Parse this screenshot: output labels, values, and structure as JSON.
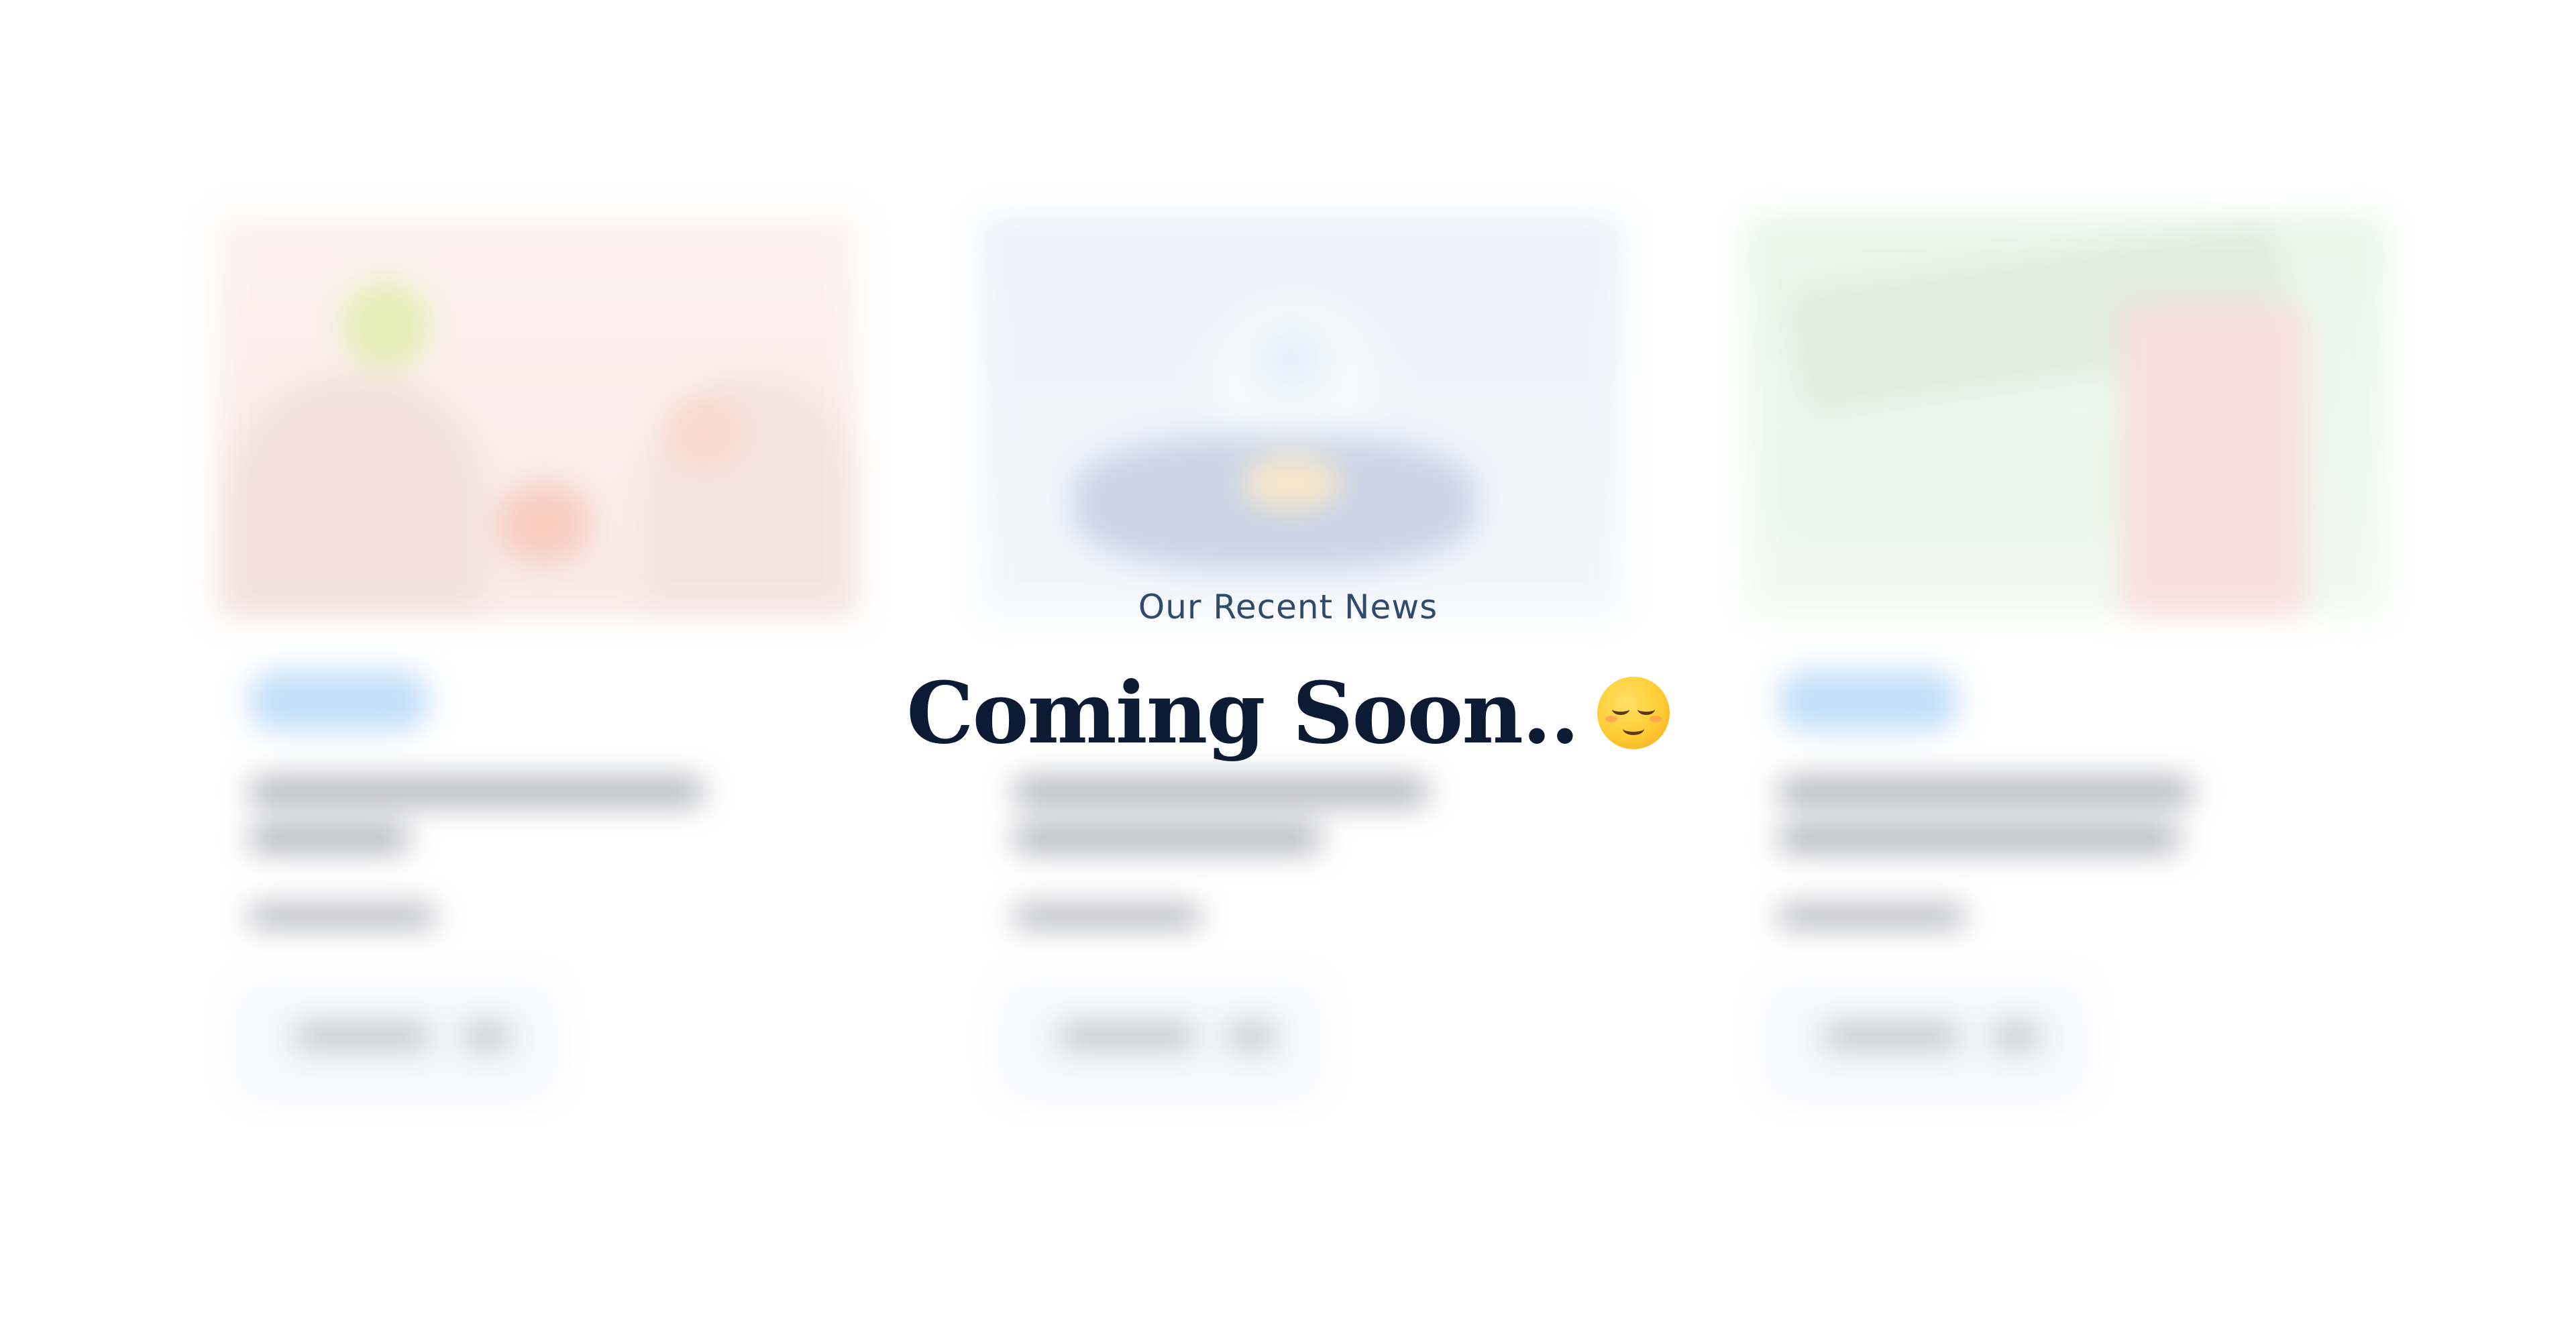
{
  "section": {
    "eyebrow": "Our Recent News",
    "headline": "Coming Soon.."
  },
  "icons": {
    "headline_emoji": "relieved-face-icon"
  },
  "colors": {
    "background": "#ffffff",
    "headline_text": "#0c1a33",
    "eyebrow_text": "#2f4a6b",
    "badge": "#8fc3f5"
  }
}
